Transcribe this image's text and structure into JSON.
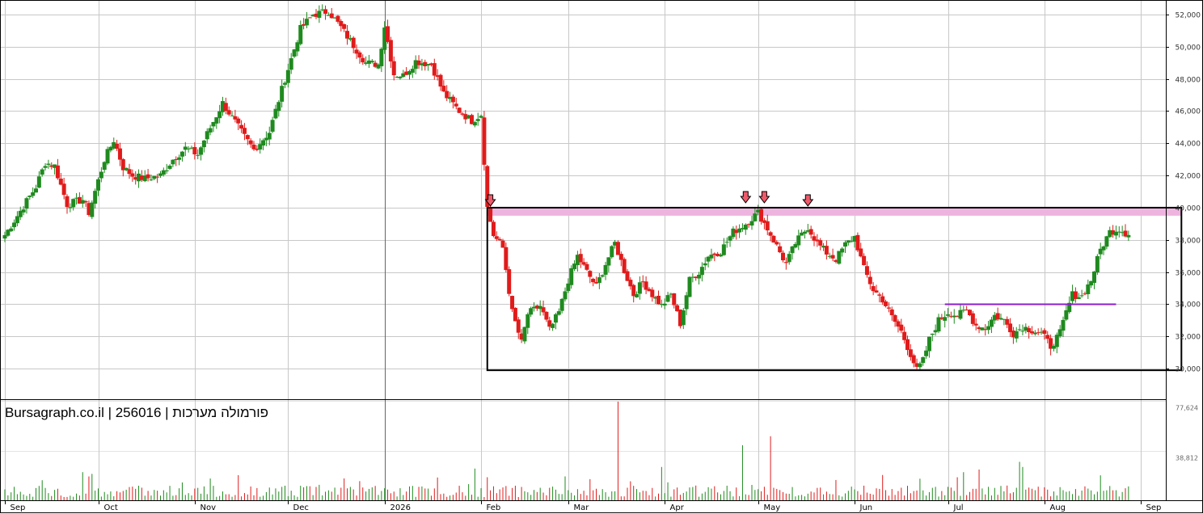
{
  "chart_data": {
    "type": "candlestick",
    "watermark": "Bursagraph.co.il | 256016 | פורמולה מערכות",
    "price_axis": {
      "ylim": [
        28200,
        52800
      ],
      "ticks": [
        "30,000",
        "32,000",
        "34,000",
        "36,000",
        "38,000",
        "40,000",
        "42,000",
        "44,000",
        "46,000",
        "48,000",
        "50,000",
        "52,000"
      ],
      "tick_values": [
        30000,
        32000,
        34000,
        36000,
        38000,
        40000,
        42000,
        44000,
        46000,
        48000,
        50000,
        52000
      ]
    },
    "volume_axis": {
      "ylim": [
        0,
        77624
      ],
      "ticks": [
        "77,624",
        "38,812"
      ],
      "tick_values": [
        77624,
        38812
      ]
    },
    "x_labels": [
      "Sep",
      "Oct",
      "Nov",
      "Dec",
      "2026",
      "Feb",
      "Mar",
      "Apr",
      "May",
      "Jun",
      "Jul",
      "Aug",
      "Sep"
    ],
    "x_label_days": [
      0,
      30,
      61,
      91,
      122,
      153,
      181,
      212,
      242,
      273,
      303,
      334,
      365
    ],
    "grid": true,
    "colors": {
      "up": "#1f8a1f",
      "down": "#e01b1b",
      "zone": "#eeb4e0",
      "resistance_line": "#8a1fcc",
      "arrow": "#ee5a6a"
    },
    "resistance_zone": {
      "from": 39500,
      "to": 40000,
      "start_day": 155,
      "end_day": 378
    },
    "range_box": {
      "low": 29900,
      "high": 40000,
      "start_day": 155,
      "end_day": 378
    },
    "resistance_line": {
      "value": 34000,
      "start_day": 302,
      "end_day": 357
    },
    "arrows": [
      {
        "day": 156,
        "value": 40000
      },
      {
        "day": 238,
        "value": 40200
      },
      {
        "day": 244,
        "value": 40200
      },
      {
        "day": 258,
        "value": 40000
      }
    ],
    "anchors": [
      [
        0,
        38300
      ],
      [
        4,
        39500
      ],
      [
        10,
        41300
      ],
      [
        13,
        42800
      ],
      [
        16,
        42600
      ],
      [
        20,
        40200
      ],
      [
        25,
        40500
      ],
      [
        27,
        39700
      ],
      [
        32,
        43000
      ],
      [
        35,
        44200
      ],
      [
        38,
        42500
      ],
      [
        41,
        42000
      ],
      [
        45,
        41800
      ],
      [
        50,
        42000
      ],
      [
        54,
        43000
      ],
      [
        58,
        43700
      ],
      [
        62,
        43300
      ],
      [
        64,
        44200
      ],
      [
        70,
        46500
      ],
      [
        74,
        45300
      ],
      [
        77,
        44400
      ],
      [
        80,
        43600
      ],
      [
        85,
        44700
      ],
      [
        90,
        48000
      ],
      [
        95,
        51100
      ],
      [
        99,
        52000
      ],
      [
        104,
        52200
      ],
      [
        108,
        51200
      ],
      [
        113,
        49800
      ],
      [
        116,
        49000
      ],
      [
        120,
        48900
      ],
      [
        122,
        51300
      ],
      [
        125,
        48300
      ],
      [
        128,
        48200
      ],
      [
        132,
        49100
      ],
      [
        137,
        48900
      ],
      [
        141,
        47100
      ],
      [
        146,
        46000
      ],
      [
        150,
        45400
      ],
      [
        153,
        45800
      ],
      [
        155,
        40000
      ],
      [
        157,
        38300
      ],
      [
        160,
        37500
      ],
      [
        163,
        33500
      ],
      [
        166,
        31600
      ],
      [
        168,
        33400
      ],
      [
        172,
        33900
      ],
      [
        175,
        32400
      ],
      [
        178,
        33500
      ],
      [
        181,
        35500
      ],
      [
        184,
        37000
      ],
      [
        187,
        36000
      ],
      [
        190,
        35100
      ],
      [
        193,
        36500
      ],
      [
        196,
        37800
      ],
      [
        199,
        36100
      ],
      [
        202,
        34600
      ],
      [
        205,
        35400
      ],
      [
        208,
        34600
      ],
      [
        211,
        33900
      ],
      [
        214,
        34600
      ],
      [
        217,
        32800
      ],
      [
        220,
        35500
      ],
      [
        223,
        36000
      ],
      [
        226,
        37000
      ],
      [
        230,
        37300
      ],
      [
        234,
        38500
      ],
      [
        238,
        39000
      ],
      [
        242,
        39700
      ],
      [
        245,
        38700
      ],
      [
        248,
        37600
      ],
      [
        251,
        36500
      ],
      [
        254,
        37800
      ],
      [
        258,
        38800
      ],
      [
        261,
        37800
      ],
      [
        264,
        37200
      ],
      [
        267,
        36800
      ],
      [
        270,
        37700
      ],
      [
        273,
        38200
      ],
      [
        276,
        36200
      ],
      [
        279,
        34900
      ],
      [
        282,
        34300
      ],
      [
        285,
        33200
      ],
      [
        288,
        32300
      ],
      [
        291,
        30900
      ],
      [
        293,
        29900
      ],
      [
        295,
        30500
      ],
      [
        297,
        31800
      ],
      [
        300,
        33000
      ],
      [
        303,
        33500
      ],
      [
        306,
        33300
      ],
      [
        309,
        33600
      ],
      [
        312,
        32700
      ],
      [
        315,
        32500
      ],
      [
        318,
        33300
      ],
      [
        321,
        33000
      ],
      [
        324,
        32200
      ],
      [
        327,
        32600
      ],
      [
        330,
        32400
      ],
      [
        333,
        32200
      ],
      [
        336,
        31400
      ],
      [
        339,
        32200
      ],
      [
        341,
        33500
      ],
      [
        343,
        34600
      ],
      [
        346,
        34500
      ],
      [
        349,
        35500
      ],
      [
        352,
        37400
      ],
      [
        355,
        38500
      ],
      [
        358,
        38700
      ],
      [
        361,
        38300
      ]
    ]
  }
}
